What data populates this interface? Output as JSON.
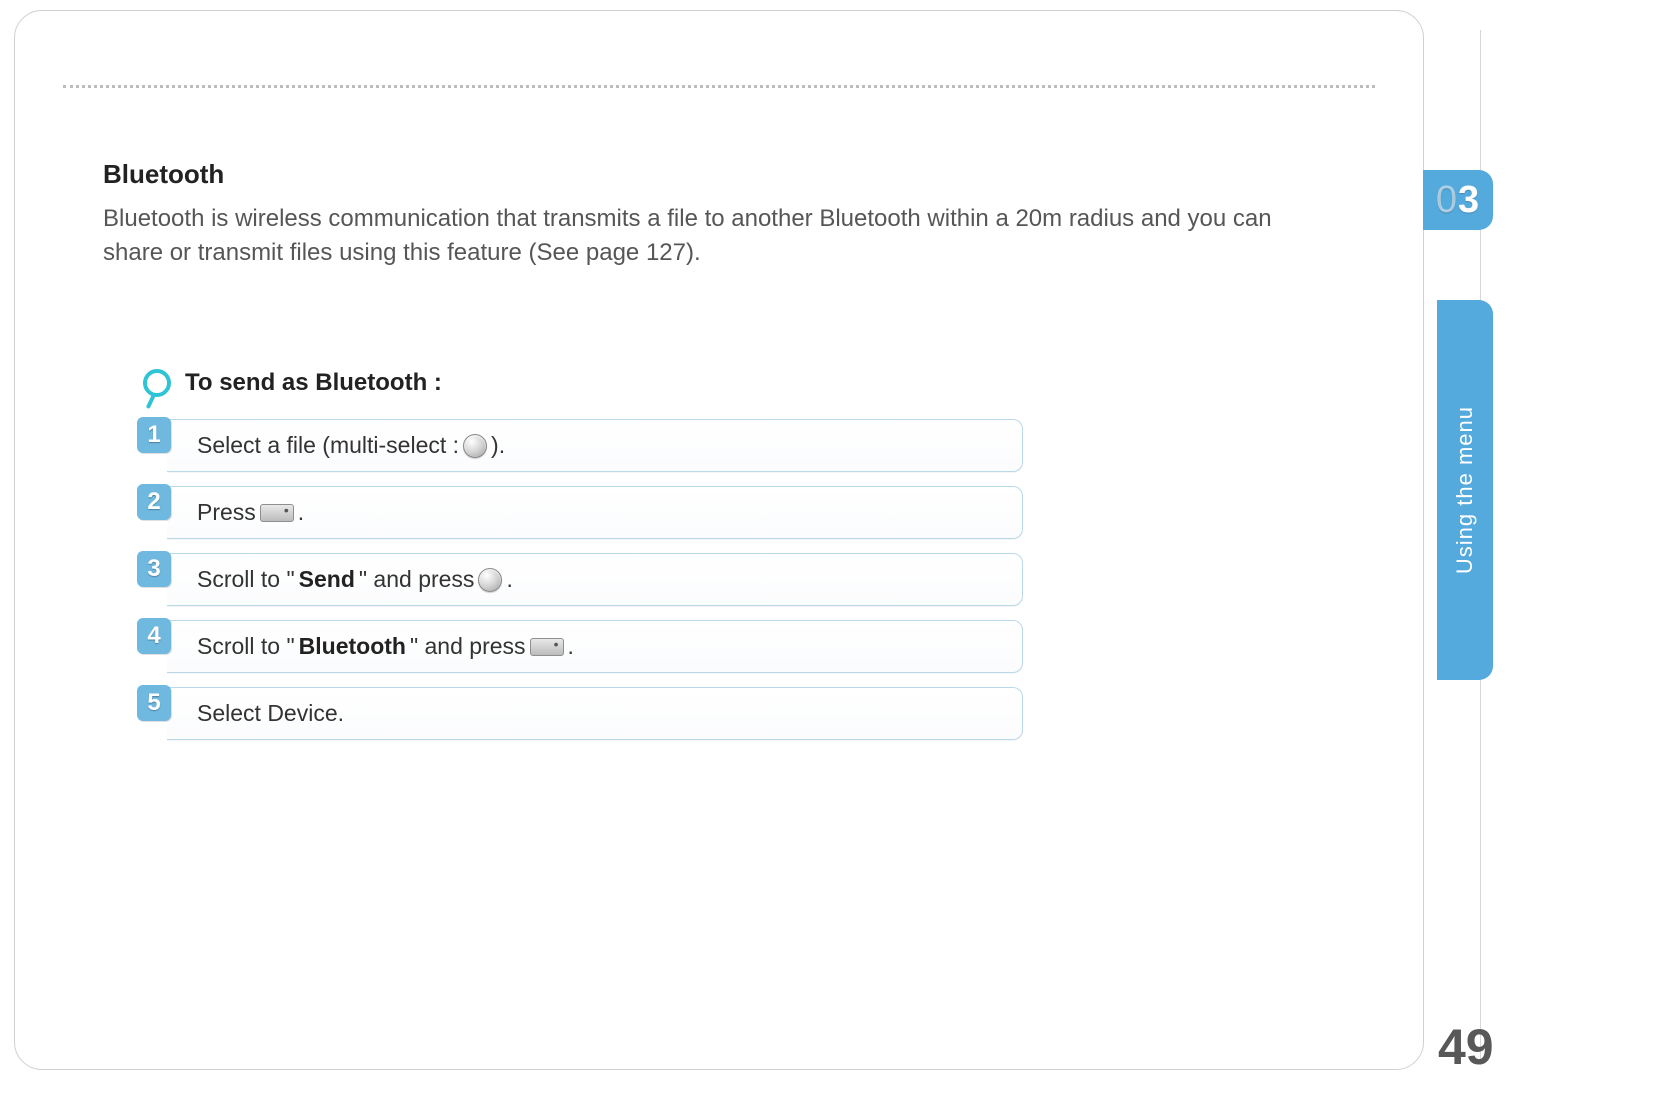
{
  "section": {
    "title": "Bluetooth",
    "intro": "Bluetooth is wireless communication that transmits a file to another Bluetooth within a 20m radius and you can share or transmit files using this feature (See page 127)."
  },
  "procedure": {
    "title": "To send as Bluetooth :",
    "steps": [
      {
        "num": "1",
        "pre": "Select a file (multi-select : ",
        "icon": "round",
        "post": ")."
      },
      {
        "num": "2",
        "pre": "Press ",
        "icon": "soft",
        "post": "."
      },
      {
        "num": "3",
        "pre": "Scroll to \"",
        "bold": "Send",
        "mid": "\" and press ",
        "icon": "round",
        "post": "."
      },
      {
        "num": "4",
        "pre": "Scroll to \"",
        "bold": "Bluetooth",
        "mid": "\" and press ",
        "icon": "soft",
        "post": "."
      },
      {
        "num": "5",
        "pre": "Select Device.",
        "icon": "",
        "post": ""
      }
    ]
  },
  "margin": {
    "chapter": "03",
    "sideLabel": "Using the menu",
    "pageNumber": "49"
  }
}
